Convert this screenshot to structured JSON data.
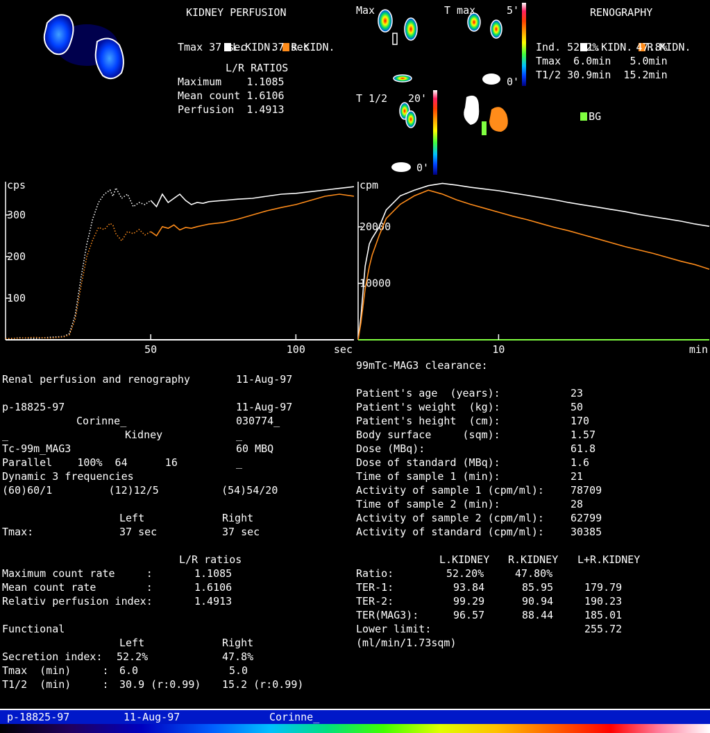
{
  "perfusion": {
    "title": "KIDNEY PERFUSION",
    "legend_left": "L.KIDN.",
    "legend_right": "R.KIDN.",
    "tmax_line": "Tmax 37 sec    37 sec",
    "ratios_title": "L/R RATIOS",
    "maximum": "Maximum    1.1085",
    "mean_count": "Mean count 1.6106",
    "perfusion": "Perfusion  1.4913"
  },
  "images": {
    "max_label": "Max",
    "tmax_label": "T max",
    "tmax_top": "5'",
    "tmax_bottom": "0'",
    "thalf_label": "T 1/2",
    "thalf_top": "20'",
    "thalf_bottom": "0'"
  },
  "renography": {
    "title": "RENOGRAPHY",
    "legend_left": "L.KIDN.",
    "legend_right": "R.KIDN.",
    "ind_line": "Ind. 52.2%      47.8%",
    "tmax_line": "Tmax  6.0min   5.0min",
    "thalf_line": "T1/2 30.9min  15.2min",
    "bg_label": "BG"
  },
  "colors": {
    "left_kidney": "#ffffff",
    "right_kidney": "#ff8c1a",
    "bg_marker": "#80ff40",
    "axis": "#ffffff",
    "reno_axis": "#80ff40"
  },
  "chart_data": [
    {
      "type": "line",
      "title": "",
      "xlabel": "sec",
      "ylabel": "cps",
      "xlim": [
        0,
        120
      ],
      "ylim": [
        0,
        380
      ],
      "xticks": [
        50,
        100
      ],
      "yticks": [
        100,
        200,
        300
      ],
      "grid": false,
      "series": [
        {
          "name": "L.KIDN.",
          "color": "#ffffff",
          "style": "dotted-then-solid",
          "x": [
            0,
            5,
            10,
            15,
            20,
            22,
            24,
            26,
            28,
            30,
            32,
            34,
            36,
            37,
            38,
            40,
            42,
            44,
            46,
            48,
            50,
            52,
            54,
            56,
            58,
            60,
            62,
            64,
            66,
            68,
            70,
            75,
            80,
            85,
            90,
            95,
            100,
            105,
            110,
            115,
            120
          ],
          "y": [
            2,
            5,
            3,
            6,
            8,
            15,
            60,
            150,
            230,
            290,
            330,
            350,
            360,
            345,
            365,
            340,
            350,
            320,
            330,
            325,
            335,
            320,
            350,
            330,
            340,
            350,
            335,
            325,
            330,
            328,
            332,
            335,
            338,
            340,
            345,
            350,
            352,
            356,
            360,
            364,
            368
          ]
        },
        {
          "name": "R.KIDN.",
          "color": "#ff8c1a",
          "style": "dotted-then-solid",
          "x": [
            0,
            5,
            10,
            15,
            20,
            22,
            24,
            26,
            28,
            30,
            32,
            34,
            36,
            37,
            38,
            40,
            42,
            44,
            46,
            48,
            50,
            52,
            54,
            56,
            58,
            60,
            62,
            64,
            66,
            68,
            70,
            75,
            80,
            85,
            90,
            95,
            100,
            105,
            110,
            115,
            120
          ],
          "y": [
            3,
            4,
            6,
            4,
            7,
            12,
            50,
            130,
            200,
            240,
            270,
            265,
            280,
            275,
            255,
            238,
            260,
            255,
            265,
            252,
            260,
            250,
            272,
            268,
            276,
            264,
            270,
            268,
            272,
            275,
            278,
            282,
            290,
            300,
            310,
            318,
            325,
            335,
            345,
            350,
            345
          ]
        }
      ]
    },
    {
      "type": "line",
      "title": "",
      "xlabel": "min",
      "ylabel": "cpm",
      "xlim": [
        0,
        25
      ],
      "ylim": [
        0,
        28000
      ],
      "xticks": [
        10
      ],
      "yticks": [
        10000,
        20000
      ],
      "grid": false,
      "series": [
        {
          "name": "L.KIDN.",
          "color": "#ffffff",
          "x": [
            0,
            0.2,
            0.5,
            0.8,
            1,
            1.5,
            2,
            3,
            4,
            5,
            6,
            7,
            8,
            9,
            10,
            11,
            12,
            13,
            14,
            15,
            16,
            17,
            18,
            19,
            20,
            21,
            22,
            23,
            24,
            25
          ],
          "y": [
            0,
            4000,
            13000,
            17000,
            18000,
            20000,
            23000,
            25500,
            26500,
            27300,
            27700,
            27400,
            27000,
            26700,
            26400,
            26000,
            25600,
            25200,
            24800,
            24300,
            23900,
            23500,
            23100,
            22700,
            22200,
            21800,
            21400,
            21000,
            20500,
            20100
          ]
        },
        {
          "name": "R.KIDN.",
          "color": "#ff8c1a",
          "x": [
            0,
            0.2,
            0.5,
            0.8,
            1,
            1.5,
            2,
            3,
            4,
            5,
            6,
            7,
            8,
            9,
            10,
            11,
            12,
            13,
            14,
            15,
            16,
            17,
            18,
            19,
            20,
            21,
            22,
            23,
            24,
            25
          ],
          "y": [
            0,
            3000,
            9000,
            13000,
            15000,
            18500,
            21500,
            24000,
            25500,
            26500,
            25800,
            24800,
            24000,
            23300,
            22600,
            21900,
            21300,
            20600,
            19900,
            19300,
            18600,
            17900,
            17200,
            16500,
            15900,
            15300,
            14600,
            13900,
            13300,
            12500
          ]
        }
      ]
    }
  ],
  "report": {
    "header": "Renal perfusion and renography",
    "header_date": "11-Aug-97",
    "patient_id": "p-18825-97",
    "patient_date": "11-Aug-97",
    "name": "Corinne_",
    "dob": "030774_",
    "organ": "Kidney",
    "organ_underscore": "_",
    "underscore1": "_",
    "tracer": "Tc-99m_MAG3",
    "dose": "60 MBQ",
    "collimator": "Parallel    100%  64      16",
    "underscore2": "_",
    "dynamic": "Dynamic 3 frequencies",
    "frames": "(60)60/1         (12)12/5          (54)54/20",
    "col_left": "Left",
    "col_right": "Right",
    "tmax_label": "Tmax:",
    "tmax_left": "37 sec",
    "tmax_right": "37 sec",
    "lr_title": "L/R ratios",
    "max_rate_label": "Maximum count rate     :",
    "max_rate": "1.1085",
    "mean_rate_label": "Mean count rate        :",
    "mean_rate": "1.6106",
    "rel_perf_label": "Relativ perfusion index:",
    "rel_perf": "1.4913",
    "functional": "Functional",
    "fcol_left": "Left",
    "fcol_right": "Right",
    "secretion_label": "Secretion index:",
    "secretion_left": "52.2%",
    "secretion_right": "47.8%",
    "ftmax_label": "Tmax  (min)     :",
    "ftmax_left": "6.0",
    "ftmax_right": "5.0",
    "fthalf_label": "T1/2  (min)     :",
    "fthalf_left": "30.9 (r:0.99)",
    "fthalf_right": "15.2 (r:0.99)"
  },
  "clearance": {
    "title": "99mTc-MAG3 clearance:",
    "rows": [
      {
        "label": "Patient's age  (years):",
        "value": "23"
      },
      {
        "label": "Patient's weight  (kg):",
        "value": "50"
      },
      {
        "label": "Patient's height  (cm):",
        "value": "170"
      },
      {
        "label": "Body surface     (sqm):",
        "value": "1.57"
      },
      {
        "label": "Dose (MBq):",
        "value": "61.8"
      },
      {
        "label": "Dose of standard (MBq):",
        "value": "1.6"
      },
      {
        "label": "Time of sample 1 (min):",
        "value": "21"
      },
      {
        "label": "Activity of sample 1 (cpm/ml):",
        "value": "78709"
      },
      {
        "label": "Time of sample 2 (min):",
        "value": "28"
      },
      {
        "label": "Activity of sample 2 (cpm/ml):",
        "value": "62799"
      },
      {
        "label": "Activity of standard (cpm/ml):",
        "value": "30385"
      }
    ],
    "col_l": "L.KIDNEY",
    "col_r": "R.KIDNEY",
    "col_lr": "L+R.KIDNEY",
    "ratio_label": "Ratio:",
    "ratio_l": "52.20%",
    "ratio_r": "47.80%",
    "ter1_label": "TER-1:",
    "ter1_l": "93.84",
    "ter1_r": "85.95",
    "ter1_lr": "179.79",
    "ter2_label": "TER-2:",
    "ter2_l": "99.29",
    "ter2_r": "90.94",
    "ter2_lr": "190.23",
    "termag_label": "TER(MAG3):",
    "termag_l": "96.57",
    "termag_r": "88.44",
    "termag_lr": "185.01",
    "lower_label": "Lower limit:",
    "lower_value": "255.72",
    "unit": "(ml/min/1.73sqm)"
  },
  "footer": {
    "patient_id": "p-18825-97",
    "date": "11-Aug-97",
    "name": "Corinne_"
  }
}
